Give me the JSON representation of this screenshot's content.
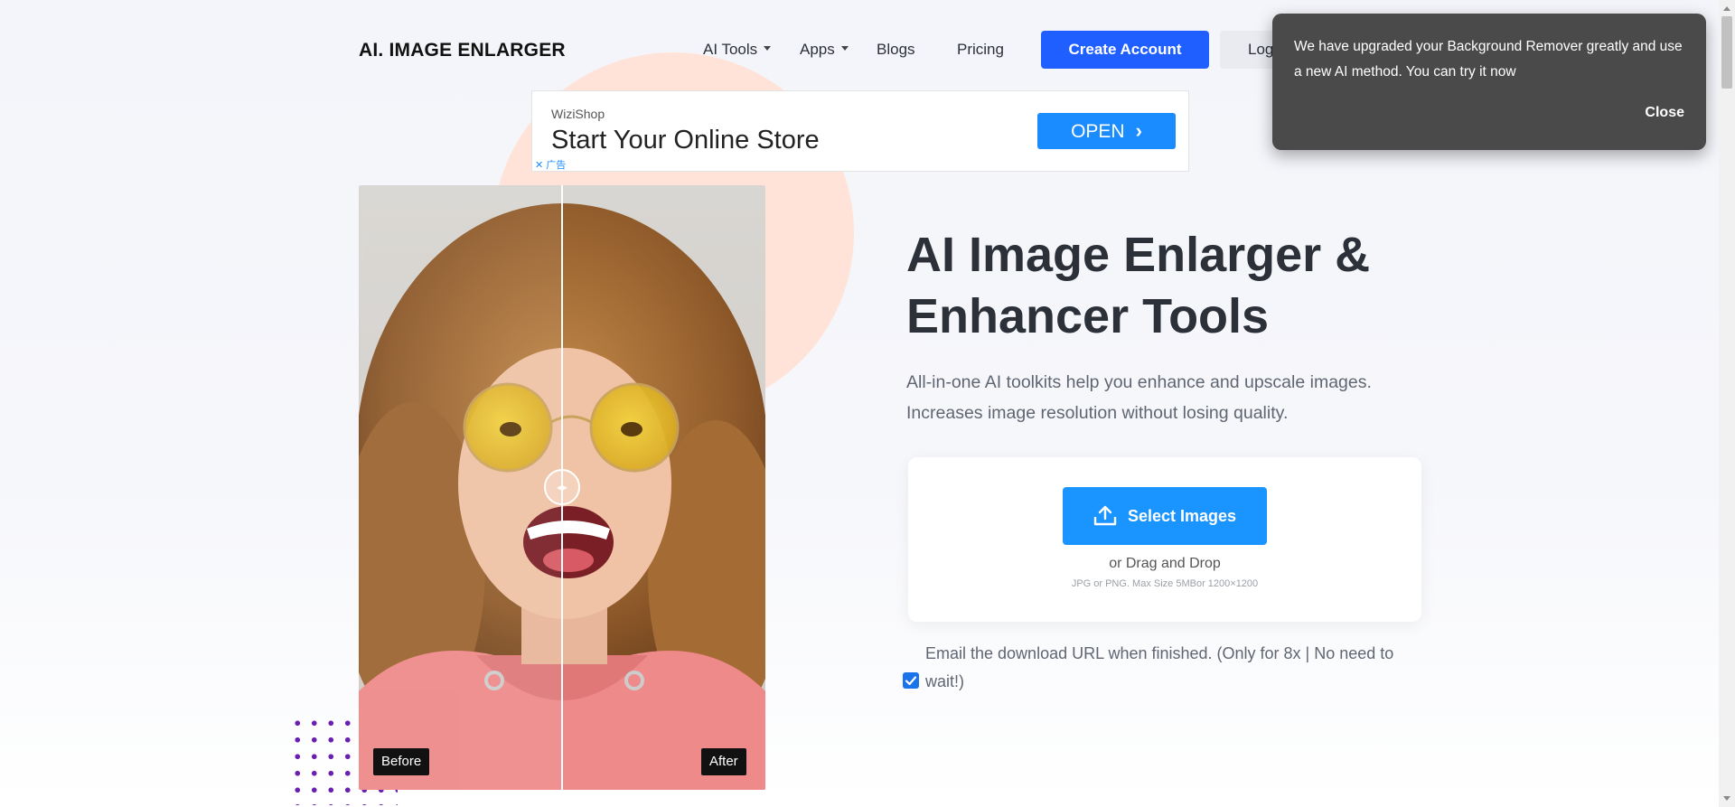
{
  "header": {
    "logo": "AI. IMAGE ENLARGER",
    "nav": [
      {
        "label": "AI Tools",
        "dropdown": true
      },
      {
        "label": "Apps",
        "dropdown": true
      },
      {
        "label": "Blogs",
        "dropdown": false
      },
      {
        "label": "Pricing",
        "dropdown": false
      }
    ],
    "create_account": "Create Account",
    "login": "Log"
  },
  "ad": {
    "brand": "WiziShop",
    "headline": "Start Your Online Store",
    "button": "OPEN",
    "adchoices": "✕ 广告"
  },
  "comparison": {
    "before_label": "Before",
    "after_label": "After",
    "split_position": 0.5
  },
  "hero": {
    "title": "AI Image Enlarger & Enhancer Tools",
    "subtitle": "All-in-one AI toolkits help you enhance and upscale images. Increases image resolution without losing quality."
  },
  "upload": {
    "button": "Select Images",
    "drag_text": "or Drag and Drop",
    "formats": "JPG or PNG. Max Size 5MBor 1200×1200"
  },
  "email_option": {
    "text": "Email the download URL when finished. (Only for 8x | No need to wait!)",
    "checked": true
  },
  "toast": {
    "message": "We have upgraded your Background Remover greatly and use a new AI method. You can try it now",
    "close": "Close"
  },
  "colors": {
    "primary": "#1f5eff",
    "upload_button": "#1a94ff",
    "ad_button": "#1a8cff",
    "toast_bg": "#4a4a4a",
    "accent_circle": "#ffe3d8",
    "dots": "#6a1fb0"
  }
}
